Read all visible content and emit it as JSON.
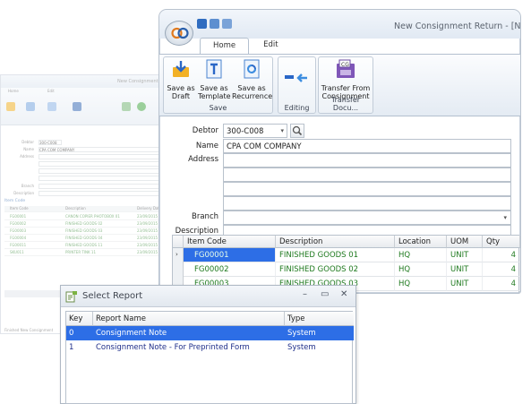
{
  "background_window": {
    "title": "New Consignment",
    "tabs": [
      "Home",
      "Edit"
    ],
    "labels": [
      "Debtor",
      "Name",
      "Address",
      "",
      "",
      "",
      "Branch",
      "Description"
    ],
    "values": [
      "300-C008",
      "CPA COM COMPANY"
    ],
    "group_label": "Item Code",
    "grid_headers": [
      "Item Code",
      "Description",
      "Delivery Date"
    ],
    "grid_rows": [
      [
        "FG00001",
        "CANON COPIER PHOTOBOX 01",
        "23/09/2015"
      ],
      [
        "FG00002",
        "FINISHED GOODS 02",
        "23/09/2015"
      ],
      [
        "FG00003",
        "FINISHED GOODS 03",
        "23/09/2015"
      ],
      [
        "FG00004",
        "FINISHED GOODS 04",
        "23/09/2015"
      ],
      [
        "FG00011",
        "FINISHED GOODS 11",
        "23/09/2015"
      ],
      [
        "SKU011",
        "PRINTER TINK 11",
        "23/09/2015"
      ]
    ],
    "footer": "Finished New Consignment"
  },
  "main_window": {
    "title": "New Consignment Return - [Ne",
    "tabs": [
      {
        "label": "Home",
        "active": true
      },
      {
        "label": "Edit",
        "active": false
      }
    ],
    "ribbon": {
      "save_group": {
        "caption": "Save",
        "buttons": [
          {
            "line1": "Save as",
            "line2": "Draft"
          },
          {
            "line1": "Save as",
            "line2": "Template"
          },
          {
            "line1": "Save as",
            "line2": "Recurrence"
          }
        ]
      },
      "editing_group": {
        "caption": "Editing"
      },
      "transfer_group": {
        "caption": "Transfer Docu...",
        "button": {
          "line1": "Transfer From",
          "line2": "Consignment"
        }
      }
    },
    "form": {
      "debtor_label": "Debtor",
      "debtor_value": "300-C008",
      "name_label": "Name",
      "name_value": "CPA COM COMPANY",
      "address_label": "Address",
      "branch_label": "Branch",
      "description_label": "Description"
    },
    "grid": {
      "headers": [
        "Item Code",
        "Description",
        "Location",
        "UOM",
        "Qty"
      ],
      "rows": [
        {
          "code": "FG00001",
          "desc": "FINISHED GOODS 01",
          "loc": "HQ",
          "uom": "UNIT",
          "qty": "4"
        },
        {
          "code": "FG00002",
          "desc": "FINISHED GOODS 02",
          "loc": "HQ",
          "uom": "UNIT",
          "qty": "4"
        },
        {
          "code": "FG00003",
          "desc": "FINISHED GOODS 03",
          "loc": "HQ",
          "uom": "UNIT",
          "qty": "4"
        }
      ]
    }
  },
  "dialog": {
    "title": "Select Report",
    "headers": [
      "Key",
      "Report Name",
      "Type"
    ],
    "rows": [
      {
        "key": "0",
        "name": "Consignment Note",
        "type": "System"
      },
      {
        "key": "1",
        "name": "Consignment Note - For Preprinted Form",
        "type": "System"
      }
    ],
    "controls": {
      "minimize": "–",
      "maximize": "▭",
      "close": "✕"
    }
  },
  "colors": {
    "selection": "#2d6ee6",
    "item_code_text": "#1f7a1f",
    "report_text": "#1f2f8a"
  }
}
